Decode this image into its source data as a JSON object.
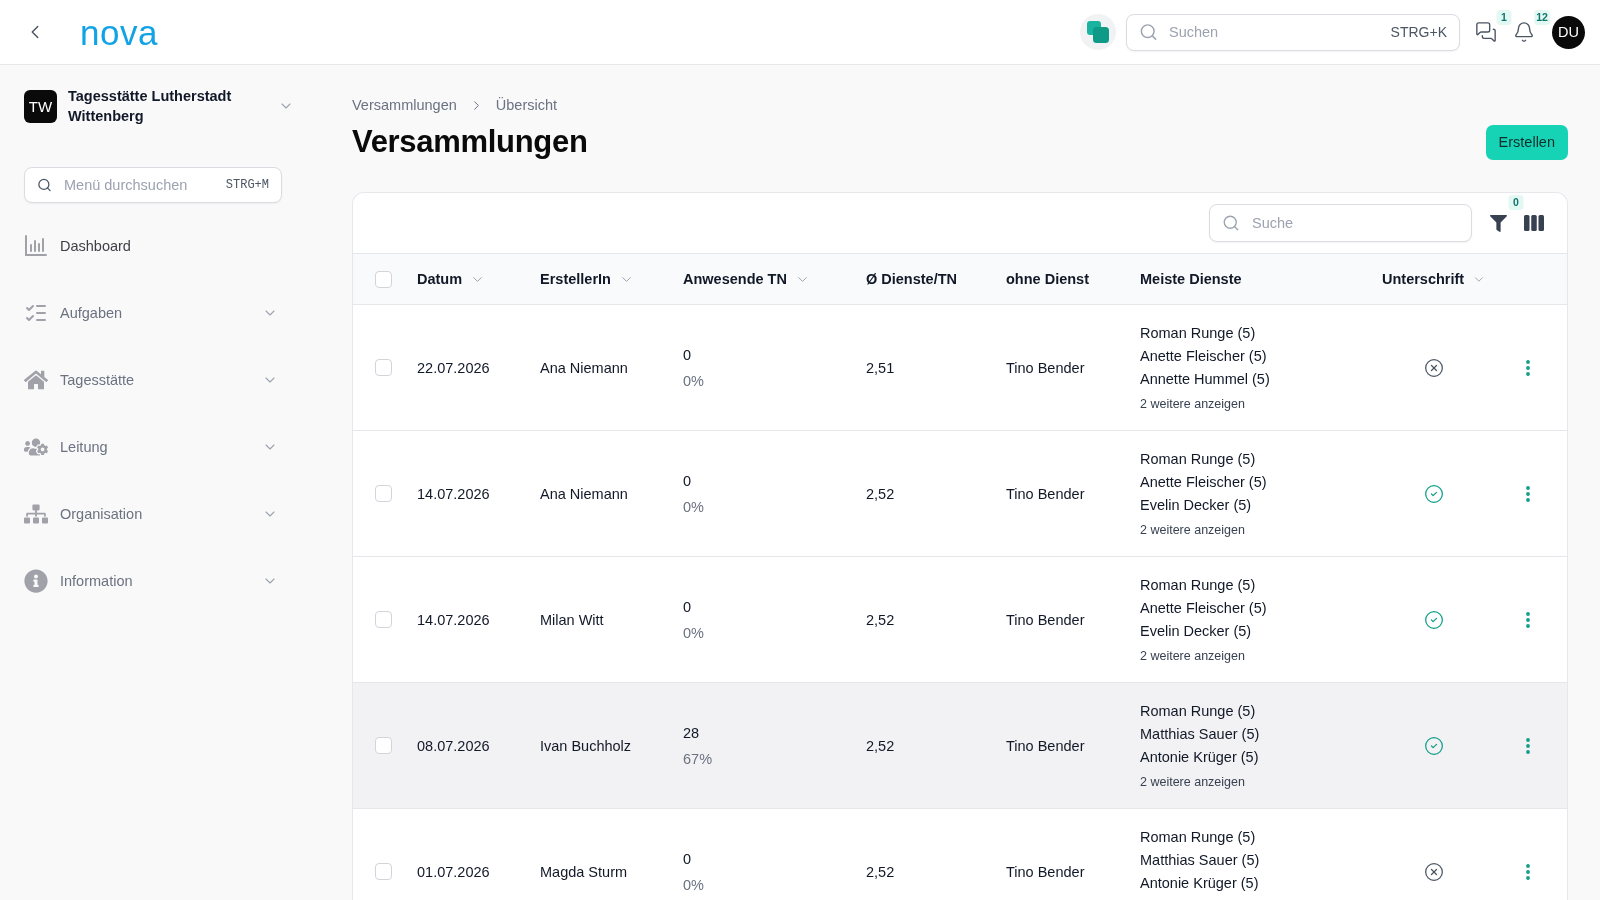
{
  "topbar": {
    "logo": "nova",
    "search": {
      "placeholder": "Suchen",
      "shortcut": "STRG+K"
    },
    "messages_badge": "1",
    "notifications_badge": "12",
    "avatar": "DU"
  },
  "sidebar": {
    "org": {
      "initials": "TW",
      "name": "Tagesstätte Lutherstadt Wittenberg"
    },
    "search": {
      "placeholder": "Menü durchsuchen",
      "shortcut": "STRG+M"
    },
    "items": [
      {
        "label": "Dashboard",
        "kind": "link"
      },
      {
        "label": "Aufgaben",
        "kind": "group",
        "expanded": false
      },
      {
        "label": "Tagesstätte",
        "kind": "group",
        "expanded": false
      },
      {
        "label": "Leitung",
        "kind": "group",
        "expanded": false
      },
      {
        "label": "Organisation",
        "kind": "group",
        "expanded": false
      },
      {
        "label": "Information",
        "kind": "group",
        "expanded": false
      }
    ]
  },
  "breadcrumb": [
    "Versammlungen",
    "Übersicht"
  ],
  "title": "Versammlungen",
  "create_button": "Erstellen",
  "table": {
    "search": {
      "placeholder": "Suche"
    },
    "filter_badge": "0",
    "select_all": {
      "checked": false
    },
    "columns": [
      {
        "label": "Datum",
        "sortable": true
      },
      {
        "label": "ErstellerIn",
        "sortable": true
      },
      {
        "label": "Anwesende TN",
        "sortable": true
      },
      {
        "label": "Ø Dienste/TN",
        "sortable": false
      },
      {
        "label": "ohne Dienst",
        "sortable": false
      },
      {
        "label": "Meiste Dienste",
        "sortable": false
      },
      {
        "label": "Unterschrift",
        "sortable": true
      }
    ],
    "rows": [
      {
        "checked": false,
        "highlighted": false,
        "date": "22.07.2026",
        "creator": "Ana Niemann",
        "present": "0",
        "present_share": "0%",
        "average": "2,51",
        "without_service": "Tino Bender",
        "top_services": [
          "Roman Runge (5)",
          "Anette Fleischer (5)",
          "Annette Hummel (5)"
        ],
        "more": "2 weitere anzeigen",
        "signed": false
      },
      {
        "checked": false,
        "highlighted": false,
        "date": "14.07.2026",
        "creator": "Ana Niemann",
        "present": "0",
        "present_share": "0%",
        "average": "2,52",
        "without_service": "Tino Bender",
        "top_services": [
          "Roman Runge (5)",
          "Anette Fleischer (5)",
          "Evelin Decker (5)"
        ],
        "more": "2 weitere anzeigen",
        "signed": true
      },
      {
        "checked": false,
        "highlighted": false,
        "date": "14.07.2026",
        "creator": "Milan Witt",
        "present": "0",
        "present_share": "0%",
        "average": "2,52",
        "without_service": "Tino Bender",
        "top_services": [
          "Roman Runge (5)",
          "Anette Fleischer (5)",
          "Evelin Decker (5)"
        ],
        "more": "2 weitere anzeigen",
        "signed": true
      },
      {
        "checked": false,
        "highlighted": true,
        "date": "08.07.2026",
        "creator": "Ivan Buchholz",
        "present": "28",
        "present_share": "67%",
        "average": "2,52",
        "without_service": "Tino Bender",
        "top_services": [
          "Roman Runge (5)",
          "Matthias Sauer (5)",
          "Antonie Krüger (5)"
        ],
        "more": "2 weitere anzeigen",
        "signed": true
      },
      {
        "checked": false,
        "highlighted": false,
        "date": "01.07.2026",
        "creator": "Magda Sturm",
        "present": "0",
        "present_share": "0%",
        "average": "2,52",
        "without_service": "Tino Bender",
        "top_services": [
          "Roman Runge (5)",
          "Matthias Sauer (5)",
          "Antonie Krüger (5)"
        ],
        "signed": false
      }
    ]
  }
}
